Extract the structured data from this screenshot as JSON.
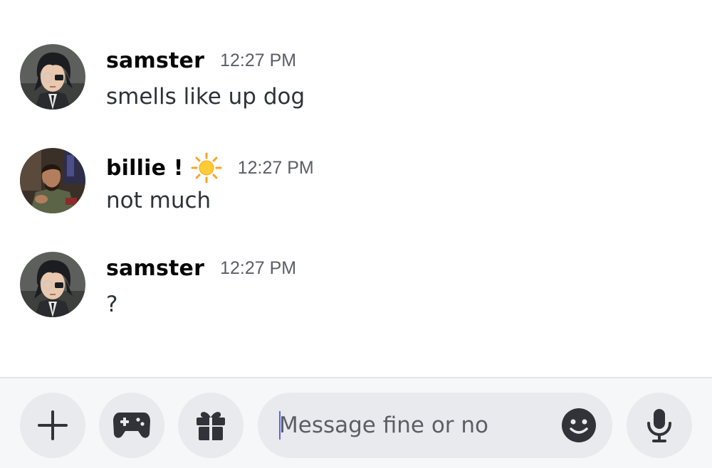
{
  "messages": [
    {
      "username": "samster",
      "timestamp": "12:27 PM",
      "text": "smells like up dog",
      "avatar": "anime-character-avatar",
      "badge": null
    },
    {
      "username": "billie !",
      "timestamp": "12:27 PM",
      "text": "not much",
      "avatar": "person-photo-avatar",
      "badge": "sun-emoji"
    },
    {
      "username": "samster",
      "timestamp": "12:27 PM",
      "text": "?",
      "avatar": "anime-character-avatar",
      "badge": null
    }
  ],
  "composer": {
    "placeholder": "Message fine or no",
    "value": "",
    "buttons": [
      "plus-icon",
      "gamepad-icon",
      "gift-icon",
      "emoji-icon",
      "microphone-icon"
    ]
  },
  "colors": {
    "background": "#ffffff",
    "composer_bg": "#f6f7f8",
    "button_bg": "#e9eaed",
    "icon": "#313338",
    "username": "#060607",
    "timestamp": "#5c5e66",
    "caret": "#5865f2"
  }
}
